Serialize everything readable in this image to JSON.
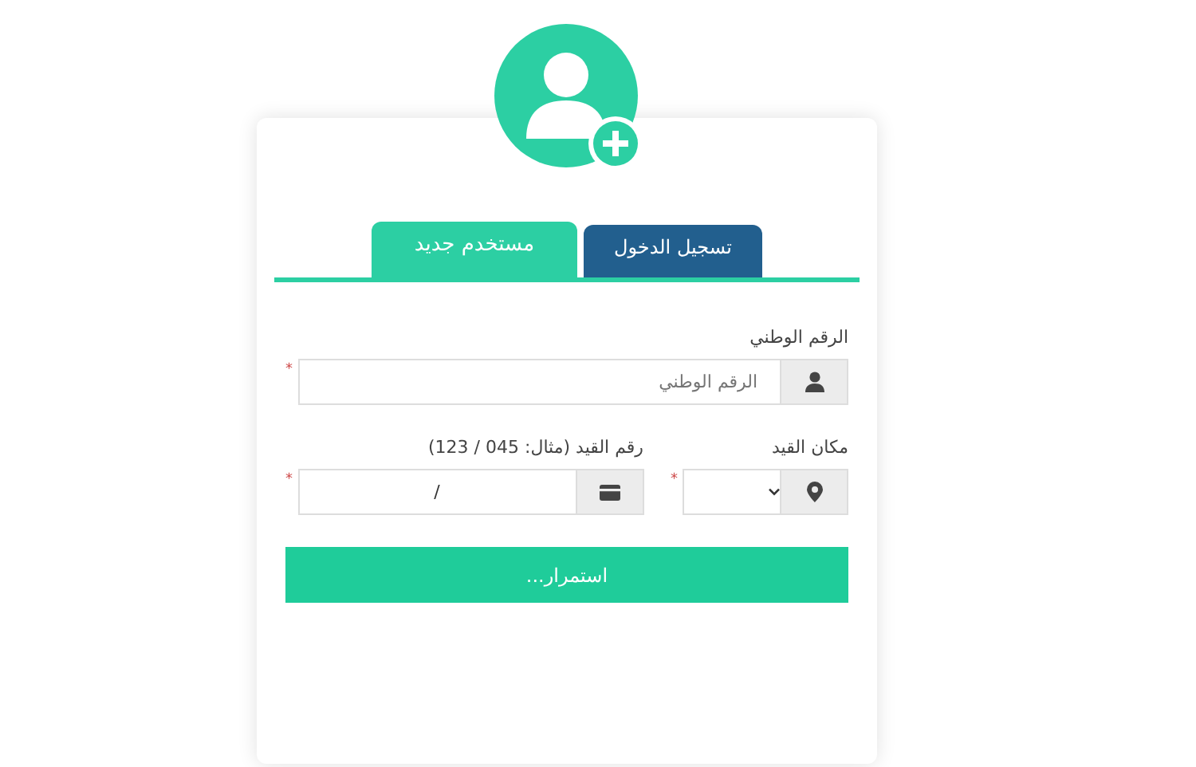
{
  "tabs": [
    {
      "label": "تسجيل الدخول",
      "selected": false
    },
    {
      "label": "مستخدم جديد",
      "selected": true
    }
  ],
  "fields": [
    {
      "kind": "text",
      "label": "الرقم الوطني",
      "placeholder": "الرقم الوطني",
      "required": "*"
    },
    {
      "kind": "select",
      "label": "مكان القيد",
      "required": "*"
    },
    {
      "kind": "text",
      "label": "رقم القيد (مثال: 045 / 123)",
      "value": "/",
      "required": "*"
    }
  ],
  "submit": {
    "label": "استمرار..."
  }
}
